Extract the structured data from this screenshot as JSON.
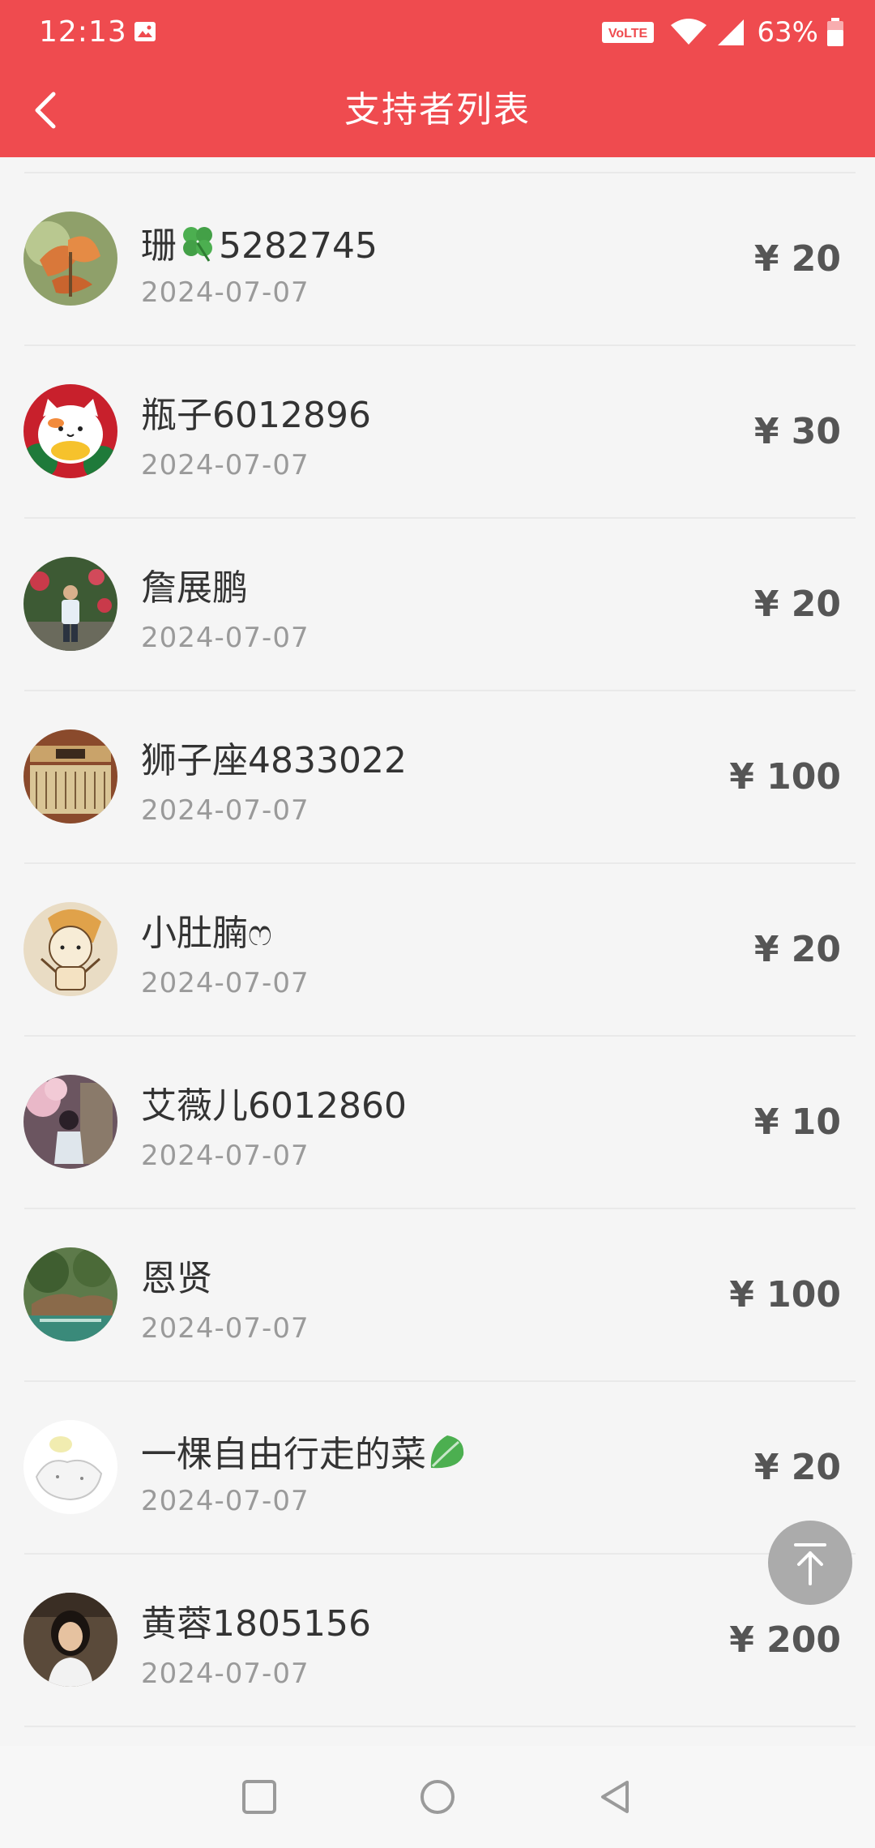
{
  "status_bar": {
    "time": "12:13",
    "volte": "VoLTE",
    "battery": "63%"
  },
  "header": {
    "title": "支持者列表"
  },
  "supporters": [
    {
      "name": "珊",
      "name_suffix": "5282745",
      "name_emoji": "four-leaf-clover",
      "date": "2024-07-07",
      "amount": "¥ 20"
    },
    {
      "name": "瓶子6012896",
      "date": "2024-07-07",
      "amount": "¥ 30"
    },
    {
      "name": "詹展鹏",
      "date": "2024-07-07",
      "amount": "¥ 20"
    },
    {
      "name": "狮子座4833022",
      "date": "2024-07-07",
      "amount": "¥ 100"
    },
    {
      "name": "小肚腩ෆ",
      "date": "2024-07-07",
      "amount": "¥ 20"
    },
    {
      "name": "艾薇儿6012860",
      "date": "2024-07-07",
      "amount": "¥ 10"
    },
    {
      "name": "恩贤",
      "date": "2024-07-07",
      "amount": "¥ 100"
    },
    {
      "name": "一棵自由行走的菜",
      "name_emoji": "leafy-green",
      "date": "2024-07-07",
      "amount": "¥ 20"
    },
    {
      "name": "黄蓉1805156",
      "date": "2024-07-07",
      "amount": "¥ 200"
    }
  ],
  "colors": {
    "header_bg": "#ef4b4f",
    "page_bg": "#f5f5f5",
    "name_text": "#333333",
    "date_text": "#9a9a9a",
    "amount_text": "#555555"
  },
  "icons": {
    "back": "chevron-left-icon",
    "to_top": "arrow-up-to-top-icon",
    "nav_recent": "square-icon",
    "nav_home": "circle-icon",
    "nav_back": "triangle-back-icon"
  }
}
